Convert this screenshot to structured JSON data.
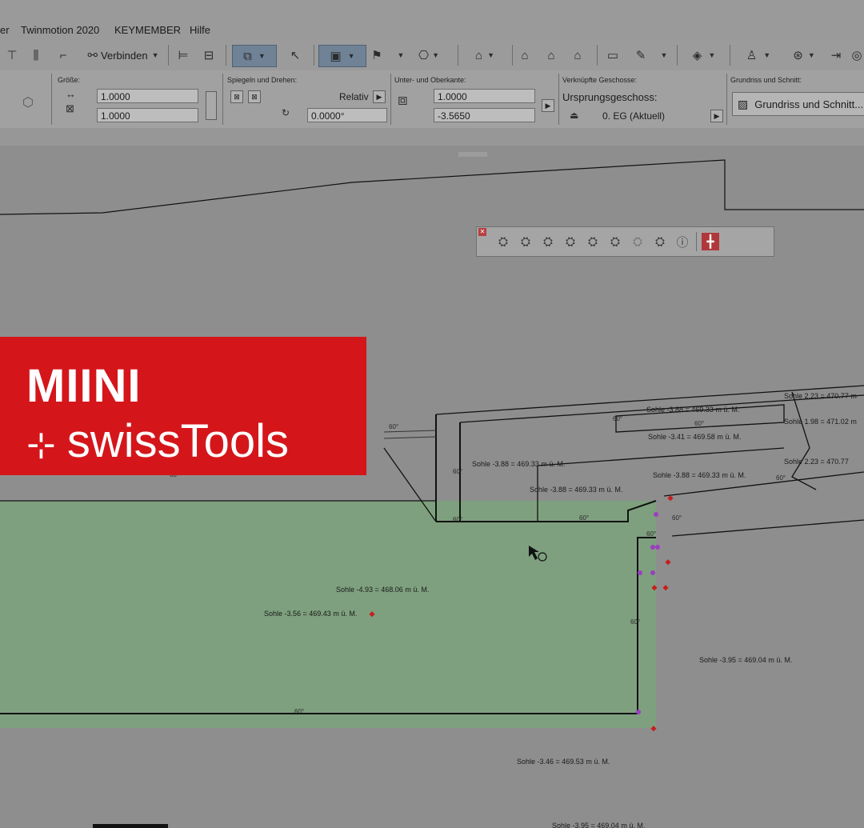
{
  "menu": {
    "items": [
      "er",
      "Twinmotion 2020",
      "KEYMEMBER",
      "Hilfe"
    ]
  },
  "toolbar": {
    "connect_label": "Verbinden"
  },
  "infobox": {
    "size_label": "Größe:",
    "size_width": "1.0000",
    "size_height": "1.0000",
    "mirror_label": "Spiegeln und Drehen:",
    "relative_label": "Relativ",
    "angle_value": "0.0000°",
    "edge_label": "Unter- und Oberkante:",
    "top_value": "1.0000",
    "bottom_value": "-3.5650",
    "linked_label": "Verknüpfte Geschosse:",
    "origin_label": "Ursprungsgeschoss:",
    "origin_value": "0. EG (Aktuell)",
    "plan_label": "Grundriss und Schnitt:",
    "plan_button": "Grundriss und Schnitt..."
  },
  "drawing": {
    "labels": [
      "Sohle -3.88 = 469.33 m ü. M.",
      "Sohle -3.41 = 469.58 m ü. M.",
      "Sohle -3.88 = 469.33 m ü. M.",
      "Sohle -3.88 = 469.33 m ü. M.",
      "Sohle -3.88 = 469.33 m ü. M.",
      "Sohle -4.93 = 468.06 m ü. M.",
      "Sohle -3.56 = 469.43 m ü. M.",
      "Sohle -3.95 = 469.04 m ü. M.",
      "Sohle -3.46 = 469.53 m ü. M.",
      "Sohle 2.23 = 470.77 m",
      "Sohle 1.98 = 471.02 m",
      "Sohle 2.23 = 470.77",
      "Sohle -3.95 = 469.04 m ü. M."
    ],
    "angle_labels": [
      "60°",
      "60°",
      "60°",
      "60°",
      "60°",
      "60°",
      "60°",
      "60°",
      "60°",
      "60°",
      "60°",
      "60°"
    ]
  },
  "logo": {
    "line1": "MIINI",
    "line2": "swissTools",
    "color": "#d4161b"
  },
  "colors": {
    "fill_area": "#7ea07e",
    "accent": "#d4161b"
  }
}
